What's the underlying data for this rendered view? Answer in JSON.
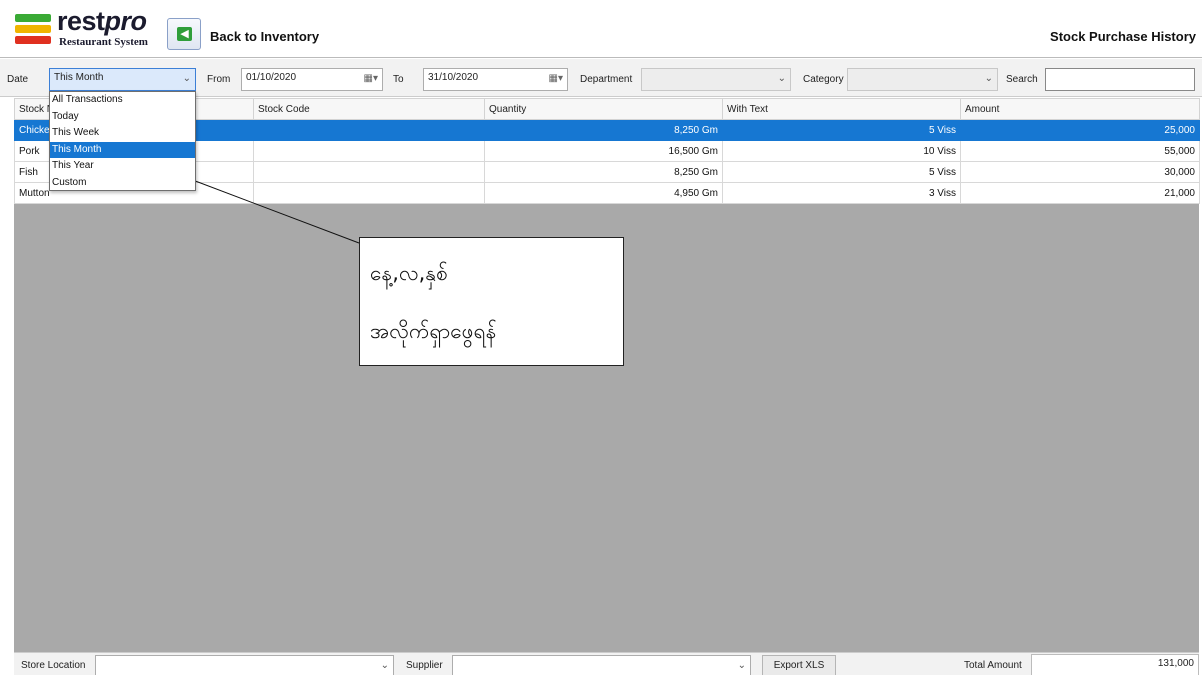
{
  "header": {
    "logo_text_a": "rest",
    "logo_text_b": "pro",
    "logo_sub": "Restaurant System",
    "back_label": "Back to Inventory",
    "page_title": "Stock Purchase History"
  },
  "filters": {
    "date_label": "Date",
    "date_value": "This Month",
    "from_label": "From",
    "from_value": "01/10/2020",
    "to_label": "To",
    "to_value": "31/10/2020",
    "department_label": "Department",
    "department_value": "",
    "category_label": "Category",
    "category_value": "",
    "search_label": "Search",
    "search_value": ""
  },
  "date_options": [
    "All Transactions",
    "Today",
    "This Week",
    "This Month",
    "This Year",
    "Custom"
  ],
  "selected_option_index": 3,
  "table": {
    "columns": [
      "Stock Name",
      "Stock Code",
      "Quantity",
      "With Text",
      "Amount"
    ],
    "rows": [
      {
        "name": "Chicken",
        "code": "",
        "quantity": "8,250 Gm",
        "with_text": "5 Viss",
        "amount": "25,000"
      },
      {
        "name": "Pork",
        "code": "",
        "quantity": "16,500 Gm",
        "with_text": "10 Viss",
        "amount": "55,000"
      },
      {
        "name": "Fish",
        "code": "",
        "quantity": "8,250 Gm",
        "with_text": "5 Viss",
        "amount": "30,000"
      },
      {
        "name": "Mutton",
        "code": "",
        "quantity": "4,950 Gm",
        "with_text": "3 Viss",
        "amount": "21,000"
      }
    ],
    "selected_row_index": 0
  },
  "callout": {
    "line1": "နေ့,လ,နှစ်",
    "line2": "အလိုက်ရှာဖွေရန်"
  },
  "footer": {
    "store_location_label": "Store Location",
    "store_location_value": "",
    "supplier_label": "Supplier",
    "supplier_value": "",
    "export_label": "Export XLS",
    "total_label": "Total Amount",
    "total_value": "131,000"
  },
  "colors": {
    "selection": "#1677d2",
    "grid_background": "#a9a9a9",
    "logo_green": "#3aaa35",
    "logo_yellow": "#f0b400",
    "logo_red": "#e03020"
  },
  "icons": {
    "back": "back-arrow-icon",
    "calendar": "calendar-icon",
    "dropdown": "chevron-down-icon"
  }
}
